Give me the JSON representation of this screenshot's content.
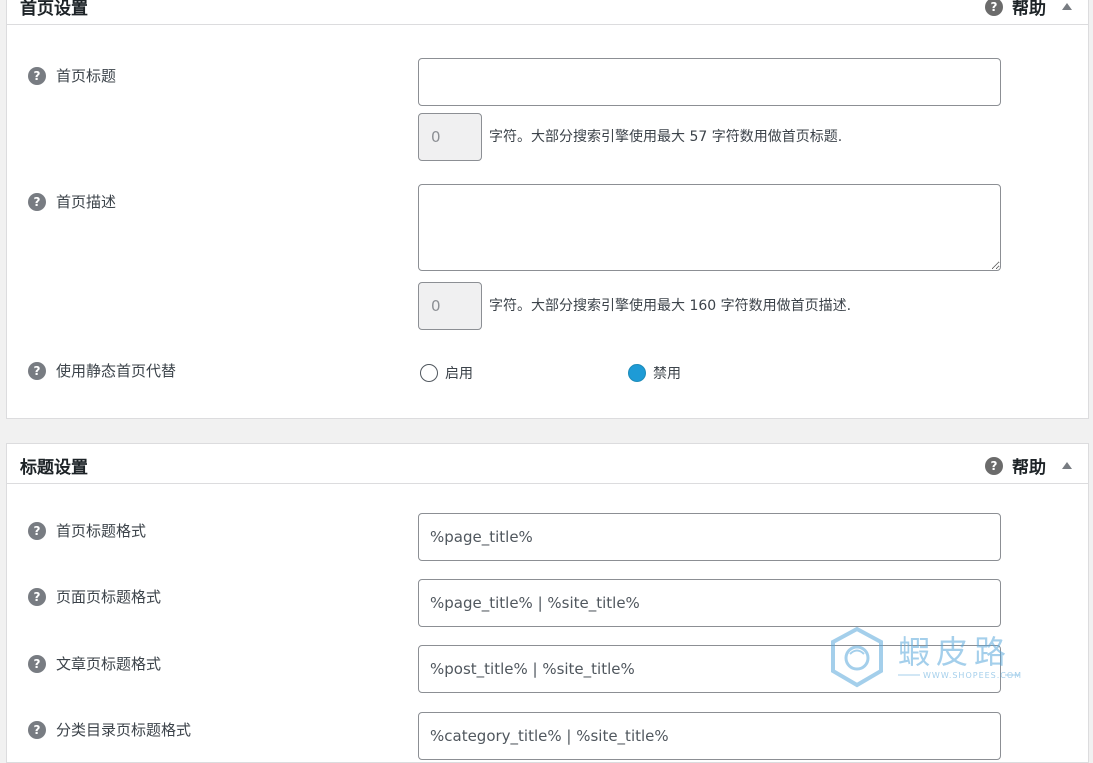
{
  "home_panel": {
    "title": "首页设置",
    "help": "帮助",
    "home_title_label": "首页标题",
    "home_title_value": "",
    "title_count": "0",
    "title_hint": "字符。大部分搜索引擎使用最大 57 字符数用做首页标题.",
    "home_desc_label": "首页描述",
    "home_desc_value": "",
    "desc_count": "0",
    "desc_hint": "字符。大部分搜索引擎使用最大 160 字符数用做首页描述.",
    "static_label": "使用静态首页代替",
    "radio_enable": "启用",
    "radio_disable": "禁用",
    "selected": "禁用"
  },
  "title_panel": {
    "title": "标题设置",
    "help": "帮助",
    "home_format_label": "首页标题格式",
    "home_format_value": "%page_title%",
    "page_format_label": "页面页标题格式",
    "page_format_value": "%page_title% | %site_title%",
    "post_format_label": "文章页标题格式",
    "post_format_value": "%post_title% | %site_title%",
    "category_format_label": "分类目录页标题格式",
    "category_format_value": "%category_title% | %site_title%"
  },
  "watermark": {
    "brand": "蝦皮路",
    "url": "WWW.SHOPEES.COM"
  },
  "colors": {
    "accent": "#1e9bd6",
    "icon_gray": "#787c82",
    "border": "#8c8f94",
    "watermark": "#5aa8dc"
  }
}
